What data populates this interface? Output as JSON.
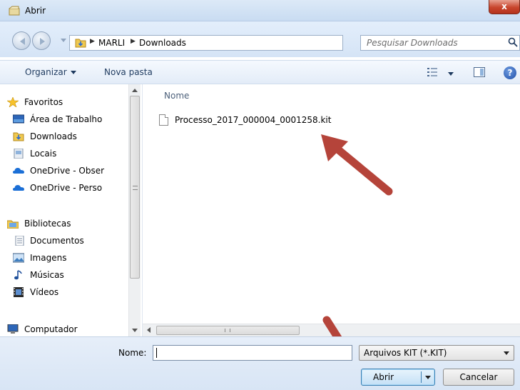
{
  "window": {
    "title": "Abrir",
    "close_label": "x"
  },
  "address": {
    "crumbs": [
      "MARLI",
      "Downloads"
    ],
    "search_placeholder": "Pesquisar Downloads"
  },
  "toolbar": {
    "organize": "Organizar",
    "new_folder": "Nova pasta",
    "help": "?"
  },
  "nav": {
    "items": [
      {
        "label": "Favoritos",
        "icon": "star-icon"
      },
      {
        "label": "Área de Trabalho",
        "icon": "desktop-icon"
      },
      {
        "label": "Downloads",
        "icon": "downloads-folder-icon"
      },
      {
        "label": "Locais",
        "icon": "recent-places-icon"
      },
      {
        "label": "OneDrive - Obser",
        "icon": "onedrive-icon"
      },
      {
        "label": "OneDrive - Perso",
        "icon": "onedrive-icon"
      },
      {
        "label": "Bibliotecas",
        "icon": "libraries-icon"
      },
      {
        "label": "Documentos",
        "icon": "documents-icon"
      },
      {
        "label": "Imagens",
        "icon": "pictures-icon"
      },
      {
        "label": "Músicas",
        "icon": "music-icon"
      },
      {
        "label": "Vídeos",
        "icon": "videos-icon"
      },
      {
        "label": "Computador",
        "icon": "computer-icon"
      }
    ]
  },
  "content": {
    "column_name": "Nome",
    "files": [
      {
        "name": "Processo_2017_000004_0001258.kit"
      }
    ]
  },
  "hscroll": {
    "grip": "III"
  },
  "bottom": {
    "name_label": "Nome:",
    "name_value": "",
    "filter_value": "Arquivos KIT (*.KIT)",
    "open_label": "Abrir",
    "cancel_label": "Cancelar"
  },
  "colors": {
    "annotation_arrow": "#b5443a",
    "title_bar": "#dce9f7",
    "close_button": "#c8452d"
  }
}
